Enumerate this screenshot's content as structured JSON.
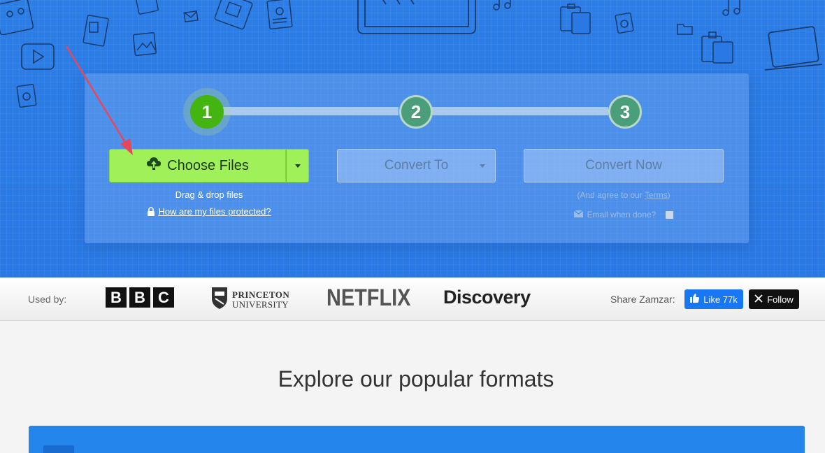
{
  "hero": {
    "steps": [
      "1",
      "2",
      "3"
    ],
    "choose_files_label": "Choose Files",
    "convert_to_label": "Convert To",
    "convert_now_label": "Convert Now",
    "drag_drop_text": "Drag & drop files",
    "protected_link": "How are my files protected?",
    "agree_prefix": "(And agree to our ",
    "terms_link": "Terms",
    "agree_suffix": ")",
    "email_label": "Email when done?"
  },
  "used_by": {
    "label": "Used by:",
    "logos": {
      "bbc": [
        "B",
        "B",
        "C"
      ],
      "princeton_line1": "PRINCETON",
      "princeton_line2": "UNIVERSITY",
      "netflix": "NETFLIX",
      "discovery": "Discovery"
    },
    "share_label": "Share Zamzar:",
    "like_label": "Like 77k",
    "follow_label": "Follow"
  },
  "main": {
    "explore_title": "Explore our popular formats"
  },
  "colors": {
    "hero_blue": "#2a78e4",
    "choose_green": "#a0f05a",
    "step_active": "#44b410",
    "step_inactive": "#4a9e7a",
    "facebook_blue": "#1877f2",
    "annotation_arrow": "#e8465a"
  }
}
